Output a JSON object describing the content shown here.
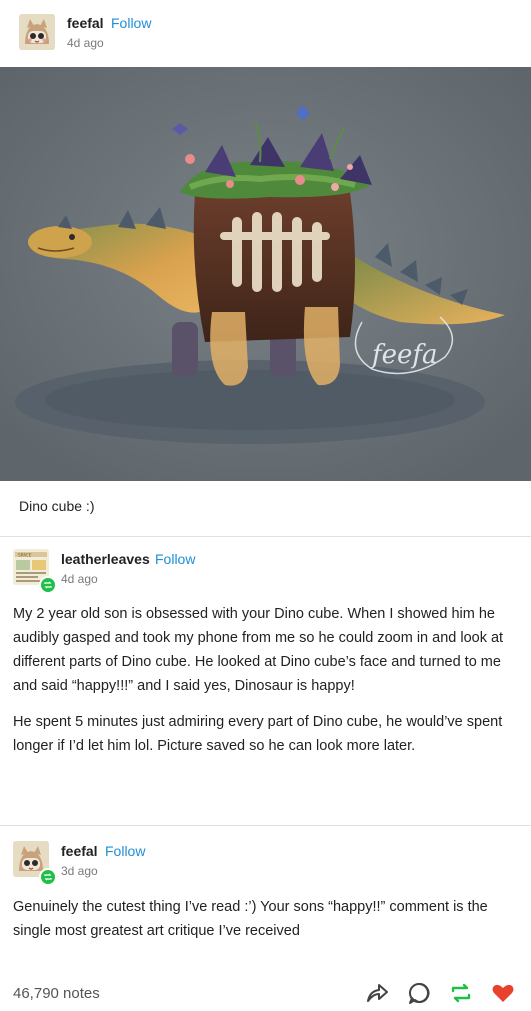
{
  "post": {
    "author": "feefal",
    "follow_label": "Follow",
    "time": "4d ago",
    "image_alt": "Illustration of a dinosaur with a brownie cube body topped with crystals, plants, flowers and butterflies",
    "watermark": "feefa",
    "caption": "Dino cube :)"
  },
  "reblogs": [
    {
      "author": "leatherleaves",
      "follow_label": "Follow",
      "time": "4d ago",
      "paragraphs": [
        "My 2 year old son is obsessed with your Dino cube. When I showed him he audibly gasped and took my phone from me so he could zoom in and look at different parts of Dino cube. He looked at Dino cube’s face and turned to me and said “happy!!!” and I said yes, Dinosaur is happy!",
        "He spent 5 minutes just admiring every part of Dino cube, he would’ve spent longer if I’d let him lol. Picture saved so he can look more later."
      ]
    },
    {
      "author": "feefal",
      "follow_label": "Follow",
      "time": "3d ago",
      "paragraphs": [
        "Genuinely the cutest thing I’ve read :’) Your sons “happy!!” comment is the single most greatest art critique I’ve received"
      ]
    }
  ],
  "footer": {
    "notes": "46,790 notes",
    "icons": [
      "share-icon",
      "reply-icon",
      "reblog-icon",
      "like-icon"
    ]
  },
  "colors": {
    "follow": "#1e8fd8",
    "reblog_green": "#1fbf4a",
    "like_red": "#e8412c"
  }
}
